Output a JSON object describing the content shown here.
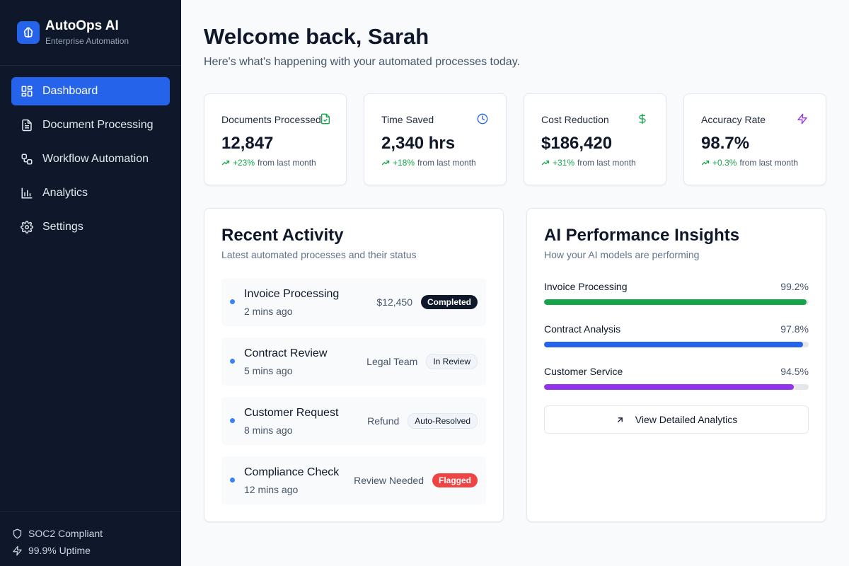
{
  "brand": {
    "title": "AutoOps AI",
    "subtitle": "Enterprise Automation",
    "logo_icon": "brain-icon",
    "accent": "#2563eb"
  },
  "nav": [
    {
      "label": "Dashboard",
      "icon": "dashboard-icon",
      "active": true
    },
    {
      "label": "Document Processing",
      "icon": "document-icon",
      "active": false
    },
    {
      "label": "Workflow Automation",
      "icon": "workflow-icon",
      "active": false
    },
    {
      "label": "Analytics",
      "icon": "bar-chart-icon",
      "active": false
    },
    {
      "label": "Settings",
      "icon": "gear-icon",
      "active": false
    }
  ],
  "footer": [
    {
      "label": "SOC2 Compliant",
      "icon": "shield-icon"
    },
    {
      "label": "99.9% Uptime",
      "icon": "bolt-icon"
    }
  ],
  "header": {
    "title": "Welcome back, Sarah",
    "subtitle": "Here's what's happening with your automated processes today."
  },
  "stats": [
    {
      "label": "Documents Processed",
      "value": "12,847",
      "change": "+23%",
      "suffix": "from last month",
      "icon": "file-check-icon",
      "icon_color": "#16a34a"
    },
    {
      "label": "Time Saved",
      "value": "2,340 hrs",
      "change": "+18%",
      "suffix": "from last month",
      "icon": "clock-icon",
      "icon_color": "#2563eb"
    },
    {
      "label": "Cost Reduction",
      "value": "$186,420",
      "change": "+31%",
      "suffix": "from last month",
      "icon": "dollar-icon",
      "icon_color": "#16a34a"
    },
    {
      "label": "Accuracy Rate",
      "value": "98.7%",
      "change": "+0.3%",
      "suffix": "from last month",
      "icon": "bolt-icon",
      "icon_color": "#9333ea"
    }
  ],
  "activity": {
    "title": "Recent Activity",
    "subtitle": "Latest automated processes and their status",
    "items": [
      {
        "title": "Invoice Processing",
        "time": "2 mins ago",
        "meta": "$12,450",
        "status": "Completed",
        "status_style": "dark"
      },
      {
        "title": "Contract Review",
        "time": "5 mins ago",
        "meta": "Legal Team",
        "status": "In Review",
        "status_style": "light"
      },
      {
        "title": "Customer Request",
        "time": "8 mins ago",
        "meta": "Refund",
        "status": "Auto-Resolved",
        "status_style": "light"
      },
      {
        "title": "Compliance Check",
        "time": "12 mins ago",
        "meta": "Review Needed",
        "status": "Flagged",
        "status_style": "red"
      }
    ]
  },
  "insights": {
    "title": "AI Performance Insights",
    "subtitle": "How your AI models are performing",
    "metrics": [
      {
        "label": "Invoice Processing",
        "value_text": "99.2%",
        "value": 99.2,
        "color": "#16a34a"
      },
      {
        "label": "Contract Analysis",
        "value_text": "97.8%",
        "value": 97.8,
        "color": "#2563eb"
      },
      {
        "label": "Customer Service",
        "value_text": "94.5%",
        "value": 94.5,
        "color": "#9333ea"
      }
    ],
    "button_label": "View Detailed Analytics",
    "button_icon": "arrow-up-right-icon"
  }
}
